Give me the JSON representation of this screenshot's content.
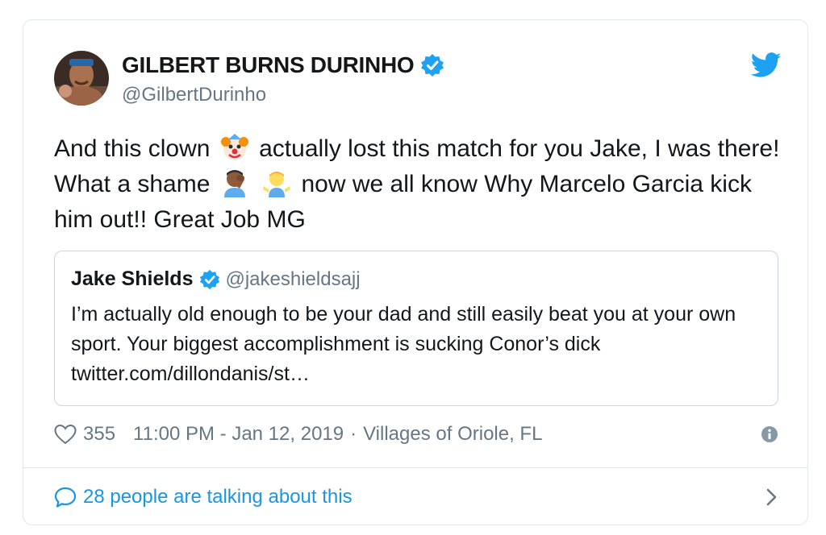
{
  "tweet": {
    "author": {
      "display_name": "GILBERT BURNS DURINHO",
      "handle": "@GilbertDurinho",
      "verified": true,
      "avatar_icon": "fighter-photo-avatar"
    },
    "text_segments": [
      "And this clown",
      "actually lost this match for you Jake, I was there! What a shame",
      "now we all know Why Marcelo Garcia kick him out!! Great Job MG"
    ],
    "emojis": [
      "clown-face-emoji",
      "man-facepalming-emoji",
      "man-shrugging-emoji"
    ],
    "quoted": {
      "display_name": "Jake Shields",
      "handle": "@jakeshieldsajj",
      "verified": true,
      "text": "I’m actually old enough to be your dad and still easily beat you at your own sport.  Your biggest accomplishment is sucking Conor’s dick twitter.com/dillondanis/st…"
    },
    "likes": "355",
    "timestamp": "11:00 PM - Jan 12, 2019",
    "separator": "·",
    "location": "Villages of Oriole, FL",
    "conversation": "28 people are talking about this"
  },
  "colors": {
    "brand_blue": "#1da1f2",
    "link_blue": "#1b95e0",
    "text": "#14171a",
    "muted": "#657786",
    "border": "#e1e8ed"
  }
}
